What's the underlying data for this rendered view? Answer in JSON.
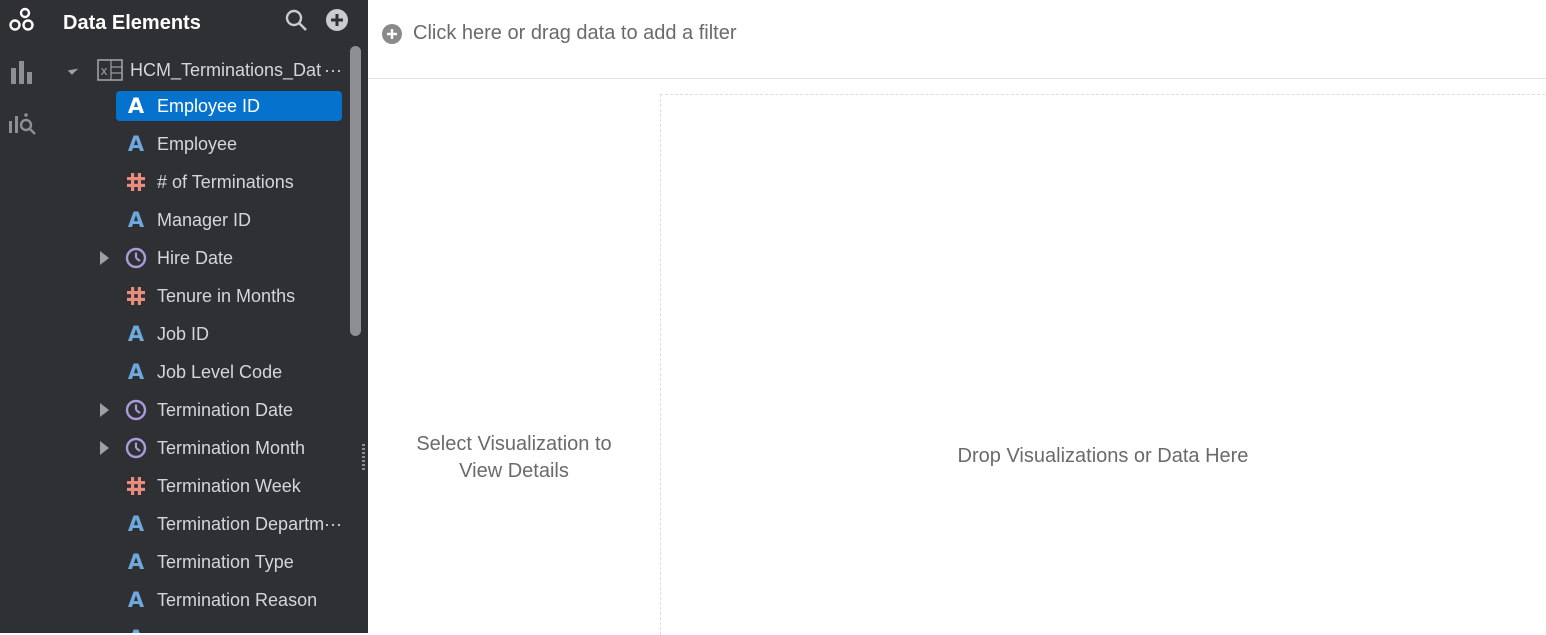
{
  "colors": {
    "panel_bg": "#2e3033",
    "selected_bg": "#0572ce",
    "attribute_icon": "#6fa8dc",
    "measure_icon": "#e88c7d",
    "date_icon": "#a99bd9"
  },
  "rail": {
    "items": [
      {
        "icon": "data-icon",
        "active": true
      },
      {
        "icon": "visualizations-icon",
        "active": false
      },
      {
        "icon": "analytics-icon",
        "active": false
      }
    ]
  },
  "panel": {
    "title": "Data Elements",
    "tools": [
      "search-icon",
      "add-icon"
    ],
    "data_source": {
      "label": "HCM_Terminations_Dat",
      "overflow": "···",
      "icon": "excel-icon"
    },
    "items": [
      {
        "label": "Employee ID",
        "type": "attribute",
        "glyph": "A",
        "selected": true,
        "expandable": false
      },
      {
        "label": "Employee",
        "type": "attribute",
        "glyph": "A",
        "selected": false,
        "expandable": false
      },
      {
        "label": "# of Terminations",
        "type": "measure",
        "glyph": "#",
        "selected": false,
        "expandable": false
      },
      {
        "label": "Manager ID",
        "type": "attribute",
        "glyph": "A",
        "selected": false,
        "expandable": false
      },
      {
        "label": "Hire Date",
        "type": "date",
        "glyph": "clock",
        "selected": false,
        "expandable": true
      },
      {
        "label": "Tenure in Months",
        "type": "measure",
        "glyph": "#",
        "selected": false,
        "expandable": false
      },
      {
        "label": "Job ID",
        "type": "attribute",
        "glyph": "A",
        "selected": false,
        "expandable": false
      },
      {
        "label": "Job Level Code",
        "type": "attribute",
        "glyph": "A",
        "selected": false,
        "expandable": false
      },
      {
        "label": "Termination Date",
        "type": "date",
        "glyph": "clock",
        "selected": false,
        "expandable": true
      },
      {
        "label": "Termination Month",
        "type": "date",
        "glyph": "clock",
        "selected": false,
        "expandable": true
      },
      {
        "label": "Termination Week",
        "type": "measure",
        "glyph": "#",
        "selected": false,
        "expandable": false
      },
      {
        "label": "Termination Departm",
        "overflow": "···",
        "type": "attribute",
        "glyph": "A",
        "selected": false,
        "expandable": false
      },
      {
        "label": "Termination Type",
        "type": "attribute",
        "glyph": "A",
        "selected": false,
        "expandable": false
      },
      {
        "label": "Termination Reason",
        "type": "attribute",
        "glyph": "A",
        "selected": false,
        "expandable": false
      },
      {
        "label": "",
        "type": "attribute",
        "glyph": "A",
        "selected": false,
        "expandable": false
      }
    ]
  },
  "filter_bar": {
    "label": "Click here or drag data to add a filter"
  },
  "details": {
    "line1": "Select Visualization to",
    "line2": "View Details"
  },
  "canvas": {
    "drop_label": "Drop Visualizations or Data Here"
  }
}
